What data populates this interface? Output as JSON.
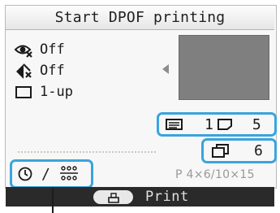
{
  "screen": {
    "title": "Start DPOF printing",
    "settings": [
      {
        "icon": "red-eye-correction-icon",
        "value": "Off"
      },
      {
        "icon": "image-optimize-icon",
        "value": "Off"
      },
      {
        "icon": "layout-frame-icon",
        "value": "1-up"
      }
    ],
    "print_info": {
      "page_count": "1",
      "sheet_count": "5",
      "copies": "6"
    },
    "date_label": "/",
    "paper_size": "P 4×6/10×15",
    "action_label": "Print"
  },
  "colors": {
    "highlight": "#3aa4dd",
    "bottom_bar": "#2a2a2a",
    "preview": "#7f7f7f"
  }
}
